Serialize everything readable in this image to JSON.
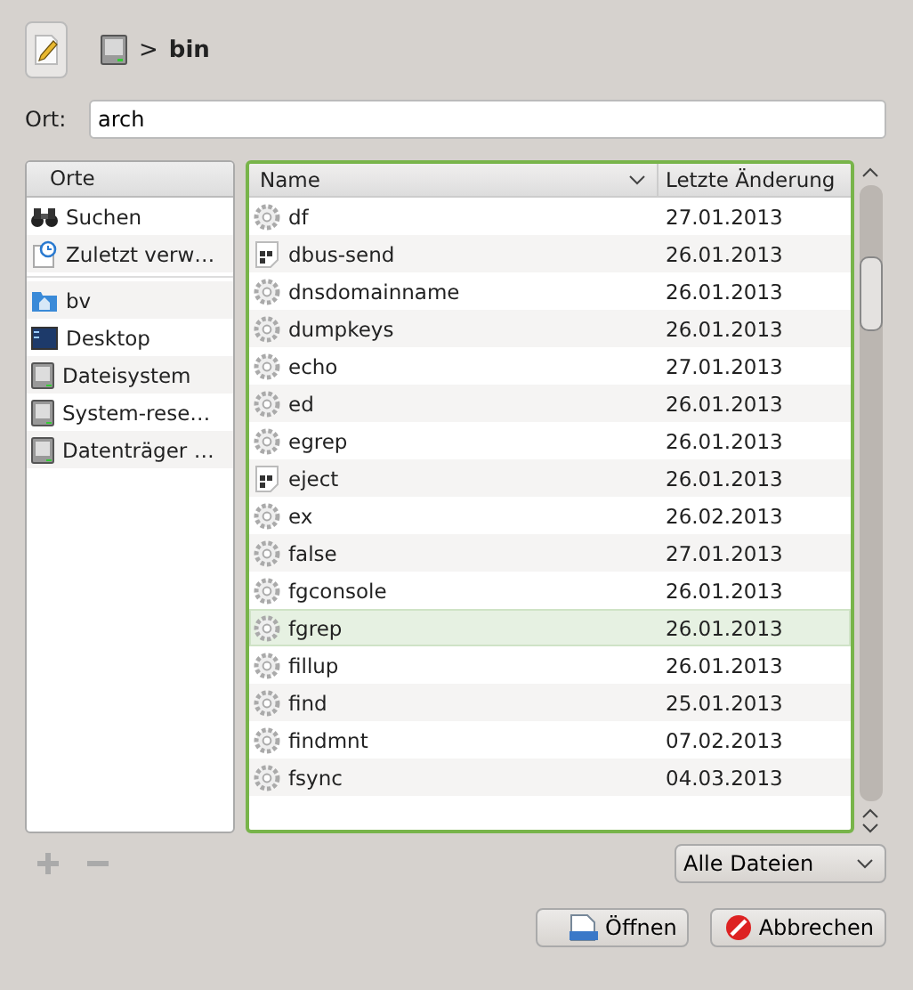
{
  "toolbar": {
    "breadcrumb_separator": ">",
    "current_folder": "bin"
  },
  "location": {
    "label": "Ort:",
    "value": "arch"
  },
  "places": {
    "header": "Orte",
    "items": [
      {
        "kind": "search",
        "label": "Suchen",
        "selected": false
      },
      {
        "kind": "recent",
        "label": "Zuletzt verw…",
        "selected": false
      },
      {
        "kind": "separator"
      },
      {
        "kind": "home",
        "label": "bv",
        "selected": false
      },
      {
        "kind": "desktop",
        "label": "Desktop",
        "selected": false
      },
      {
        "kind": "drive",
        "label": "Dateisystem",
        "selected": false
      },
      {
        "kind": "drive",
        "label": "System-rese…",
        "selected": false
      },
      {
        "kind": "drive",
        "label": "Datenträger …",
        "selected": false
      }
    ]
  },
  "files": {
    "columns": [
      "Name",
      "Letzte Änderung"
    ],
    "rows": [
      {
        "kind": "exec",
        "name": "df",
        "date": "27.01.2013",
        "selected": false
      },
      {
        "kind": "binary",
        "name": "dbus-send",
        "date": "26.01.2013",
        "selected": false
      },
      {
        "kind": "exec",
        "name": "dnsdomainname",
        "date": "26.01.2013",
        "selected": false
      },
      {
        "kind": "exec",
        "name": "dumpkeys",
        "date": "26.01.2013",
        "selected": false
      },
      {
        "kind": "exec",
        "name": "echo",
        "date": "27.01.2013",
        "selected": false
      },
      {
        "kind": "exec",
        "name": "ed",
        "date": "26.01.2013",
        "selected": false
      },
      {
        "kind": "exec",
        "name": "egrep",
        "date": "26.01.2013",
        "selected": false
      },
      {
        "kind": "binary",
        "name": "eject",
        "date": "26.01.2013",
        "selected": false
      },
      {
        "kind": "exec",
        "name": "ex",
        "date": "26.02.2013",
        "selected": false
      },
      {
        "kind": "exec",
        "name": "false",
        "date": "27.01.2013",
        "selected": false
      },
      {
        "kind": "exec",
        "name": "fgconsole",
        "date": "26.01.2013",
        "selected": false
      },
      {
        "kind": "exec",
        "name": "fgrep",
        "date": "26.01.2013",
        "selected": true
      },
      {
        "kind": "exec",
        "name": "fillup",
        "date": "26.01.2013",
        "selected": false
      },
      {
        "kind": "exec",
        "name": "find",
        "date": "25.01.2013",
        "selected": false
      },
      {
        "kind": "exec",
        "name": "findmnt",
        "date": "07.02.2013",
        "selected": false
      },
      {
        "kind": "exec",
        "name": "fsync",
        "date": "04.03.2013",
        "selected": false
      }
    ]
  },
  "filter": {
    "value": "Alle Dateien"
  },
  "buttons": [
    {
      "kind": "open",
      "label": "Öffnen"
    },
    {
      "kind": "cancel",
      "label": "Abbrechen"
    }
  ]
}
